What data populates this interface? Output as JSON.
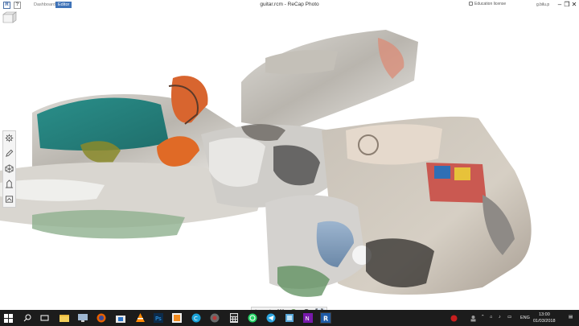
{
  "app": {
    "logo_letter": "R",
    "help_label": "?",
    "title": "guitar.rcm - ReCap Photo",
    "tabs": [
      {
        "label": "Dashboard",
        "active": false
      },
      {
        "label": "Editor",
        "active": true
      }
    ],
    "license_label": "Education license",
    "user_label": "g.bilu.p",
    "accent_color": "#3f73b8"
  },
  "viewport": {
    "content": "3d-mesh-guitar-scene",
    "nav_cube_icon": "view-cube-icon"
  },
  "left_tools": [
    {
      "icon": "settings-icon"
    },
    {
      "icon": "pencil-icon"
    },
    {
      "icon": "mesh-icon"
    },
    {
      "icon": "measure-icon"
    },
    {
      "icon": "export-icon"
    }
  ],
  "bottom_tools": [
    {
      "icon": "undo-icon"
    },
    {
      "icon": "redo-icon"
    },
    {
      "icon": "slice-icon"
    },
    {
      "icon": "materials-icon"
    },
    {
      "icon": "view-options-icon"
    },
    {
      "icon": "fit-view-icon"
    }
  ],
  "taskbar": {
    "time": "13:00",
    "date": "01/03/2018",
    "language": "ENG",
    "apps": [
      "start-icon",
      "search-icon",
      "task-view-icon",
      "file-explorer-icon",
      "desktop-icon",
      "firefox-icon",
      "store-icon",
      "vlc-icon",
      "photoshop-icon",
      "blender-icon",
      "ccleaner-icon",
      "media-icon",
      "calculator-icon",
      "whatsapp-icon",
      "telegram-icon",
      "notes-icon",
      "onenote-icon",
      "recap-icon"
    ]
  }
}
